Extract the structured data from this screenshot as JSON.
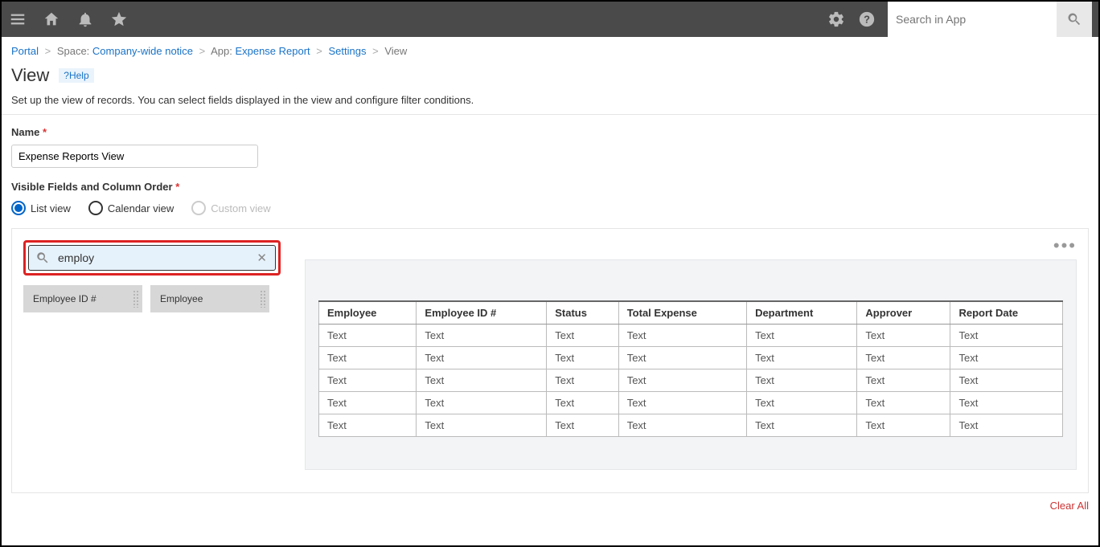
{
  "topbar": {
    "search_placeholder": "Search in App"
  },
  "breadcrumb": {
    "portal": "Portal",
    "space_label": "Space:",
    "space_name": "Company-wide notice",
    "app_label": "App:",
    "app_name": "Expense Report",
    "settings": "Settings",
    "current": "View"
  },
  "page": {
    "title": "View",
    "help": "?Help",
    "description": "Set up the view of records. You can select fields displayed in the view and configure filter conditions."
  },
  "form": {
    "name_label": "Name",
    "name_value": "Expense Reports View",
    "visible_label": "Visible Fields and Column Order",
    "radios": {
      "list": "List view",
      "calendar": "Calendar view",
      "custom": "Custom view"
    }
  },
  "fieldpanel": {
    "search_value": "employ",
    "chips": [
      "Employee ID #",
      "Employee"
    ],
    "columns": [
      "Employee",
      "Employee ID #",
      "Status",
      "Total Expense",
      "Department",
      "Approver",
      "Report Date"
    ],
    "cell_text": "Text",
    "row_count": 5,
    "clear_all": "Clear All"
  }
}
